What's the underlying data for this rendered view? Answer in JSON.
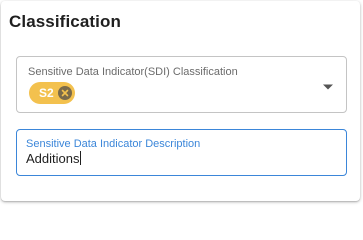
{
  "section": {
    "title": "Classification"
  },
  "sdi_classification": {
    "label": "Sensitive Data Indicator(SDI) Classification",
    "selected_chips": [
      {
        "label": "S2"
      }
    ]
  },
  "sdi_description": {
    "label": "Sensitive Data Indicator Description",
    "value": "Additions"
  },
  "colors": {
    "accent": "#3b86d9",
    "chip": "#f3c14e"
  }
}
